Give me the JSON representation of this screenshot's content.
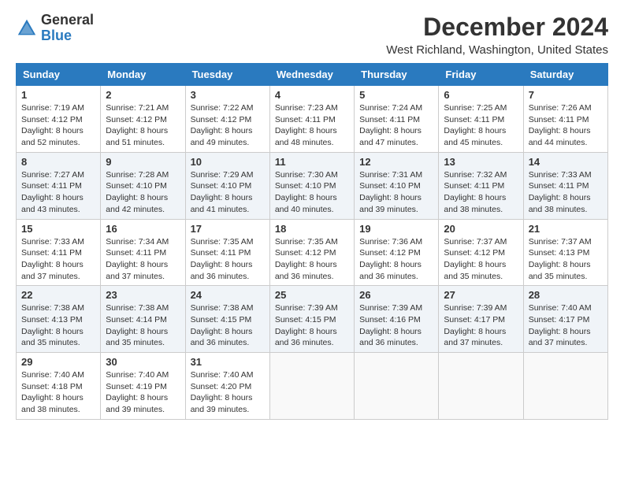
{
  "header": {
    "logo_general": "General",
    "logo_blue": "Blue",
    "month_title": "December 2024",
    "location": "West Richland, Washington, United States"
  },
  "days_of_week": [
    "Sunday",
    "Monday",
    "Tuesday",
    "Wednesday",
    "Thursday",
    "Friday",
    "Saturday"
  ],
  "weeks": [
    [
      {
        "day": "1",
        "sunrise": "7:19 AM",
        "sunset": "4:12 PM",
        "daylight": "8 hours and 52 minutes."
      },
      {
        "day": "2",
        "sunrise": "7:21 AM",
        "sunset": "4:12 PM",
        "daylight": "8 hours and 51 minutes."
      },
      {
        "day": "3",
        "sunrise": "7:22 AM",
        "sunset": "4:12 PM",
        "daylight": "8 hours and 49 minutes."
      },
      {
        "day": "4",
        "sunrise": "7:23 AM",
        "sunset": "4:11 PM",
        "daylight": "8 hours and 48 minutes."
      },
      {
        "day": "5",
        "sunrise": "7:24 AM",
        "sunset": "4:11 PM",
        "daylight": "8 hours and 47 minutes."
      },
      {
        "day": "6",
        "sunrise": "7:25 AM",
        "sunset": "4:11 PM",
        "daylight": "8 hours and 45 minutes."
      },
      {
        "day": "7",
        "sunrise": "7:26 AM",
        "sunset": "4:11 PM",
        "daylight": "8 hours and 44 minutes."
      }
    ],
    [
      {
        "day": "8",
        "sunrise": "7:27 AM",
        "sunset": "4:11 PM",
        "daylight": "8 hours and 43 minutes."
      },
      {
        "day": "9",
        "sunrise": "7:28 AM",
        "sunset": "4:10 PM",
        "daylight": "8 hours and 42 minutes."
      },
      {
        "day": "10",
        "sunrise": "7:29 AM",
        "sunset": "4:10 PM",
        "daylight": "8 hours and 41 minutes."
      },
      {
        "day": "11",
        "sunrise": "7:30 AM",
        "sunset": "4:10 PM",
        "daylight": "8 hours and 40 minutes."
      },
      {
        "day": "12",
        "sunrise": "7:31 AM",
        "sunset": "4:10 PM",
        "daylight": "8 hours and 39 minutes."
      },
      {
        "day": "13",
        "sunrise": "7:32 AM",
        "sunset": "4:11 PM",
        "daylight": "8 hours and 38 minutes."
      },
      {
        "day": "14",
        "sunrise": "7:33 AM",
        "sunset": "4:11 PM",
        "daylight": "8 hours and 38 minutes."
      }
    ],
    [
      {
        "day": "15",
        "sunrise": "7:33 AM",
        "sunset": "4:11 PM",
        "daylight": "8 hours and 37 minutes."
      },
      {
        "day": "16",
        "sunrise": "7:34 AM",
        "sunset": "4:11 PM",
        "daylight": "8 hours and 37 minutes."
      },
      {
        "day": "17",
        "sunrise": "7:35 AM",
        "sunset": "4:11 PM",
        "daylight": "8 hours and 36 minutes."
      },
      {
        "day": "18",
        "sunrise": "7:35 AM",
        "sunset": "4:12 PM",
        "daylight": "8 hours and 36 minutes."
      },
      {
        "day": "19",
        "sunrise": "7:36 AM",
        "sunset": "4:12 PM",
        "daylight": "8 hours and 36 minutes."
      },
      {
        "day": "20",
        "sunrise": "7:37 AM",
        "sunset": "4:12 PM",
        "daylight": "8 hours and 35 minutes."
      },
      {
        "day": "21",
        "sunrise": "7:37 AM",
        "sunset": "4:13 PM",
        "daylight": "8 hours and 35 minutes."
      }
    ],
    [
      {
        "day": "22",
        "sunrise": "7:38 AM",
        "sunset": "4:13 PM",
        "daylight": "8 hours and 35 minutes."
      },
      {
        "day": "23",
        "sunrise": "7:38 AM",
        "sunset": "4:14 PM",
        "daylight": "8 hours and 35 minutes."
      },
      {
        "day": "24",
        "sunrise": "7:38 AM",
        "sunset": "4:15 PM",
        "daylight": "8 hours and 36 minutes."
      },
      {
        "day": "25",
        "sunrise": "7:39 AM",
        "sunset": "4:15 PM",
        "daylight": "8 hours and 36 minutes."
      },
      {
        "day": "26",
        "sunrise": "7:39 AM",
        "sunset": "4:16 PM",
        "daylight": "8 hours and 36 minutes."
      },
      {
        "day": "27",
        "sunrise": "7:39 AM",
        "sunset": "4:17 PM",
        "daylight": "8 hours and 37 minutes."
      },
      {
        "day": "28",
        "sunrise": "7:40 AM",
        "sunset": "4:17 PM",
        "daylight": "8 hours and 37 minutes."
      }
    ],
    [
      {
        "day": "29",
        "sunrise": "7:40 AM",
        "sunset": "4:18 PM",
        "daylight": "8 hours and 38 minutes."
      },
      {
        "day": "30",
        "sunrise": "7:40 AM",
        "sunset": "4:19 PM",
        "daylight": "8 hours and 39 minutes."
      },
      {
        "day": "31",
        "sunrise": "7:40 AM",
        "sunset": "4:20 PM",
        "daylight": "8 hours and 39 minutes."
      },
      null,
      null,
      null,
      null
    ]
  ]
}
